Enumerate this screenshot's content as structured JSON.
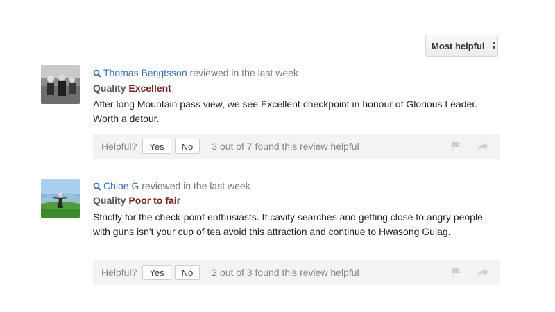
{
  "sort": {
    "label": "Most helpful"
  },
  "reviews": [
    {
      "author": "Thomas Bengtsson",
      "when": " reviewed in the last week",
      "quality_label": "Quality ",
      "quality_value": "Excellent",
      "text": "After long Mountain pass view, we see Excellent checkpoint in honour of Glorious Leader. Worth a detour.",
      "helpful_label": "Helpful?",
      "yes_label": "Yes",
      "no_label": "No",
      "helpful_count": "3 out of 7 found this review helpful"
    },
    {
      "author": "Chloe G",
      "when": " reviewed in the last week",
      "quality_label": "Quality ",
      "quality_value": "Poor to fair",
      "text": "Strictly for the check-point enthusiasts. If cavity searches and getting close to angry people with guns isn't your cup of tea avoid this attraction and continue to Hwasong Gulag.",
      "helpful_label": "Helpful?",
      "yes_label": "Yes",
      "no_label": "No",
      "helpful_count": "2 out of 3 found this review helpful"
    }
  ],
  "colors": {
    "author_link": "#3b6fb6",
    "quality_value": "#7a1f1f",
    "bar_bg": "#f3f3f3"
  }
}
